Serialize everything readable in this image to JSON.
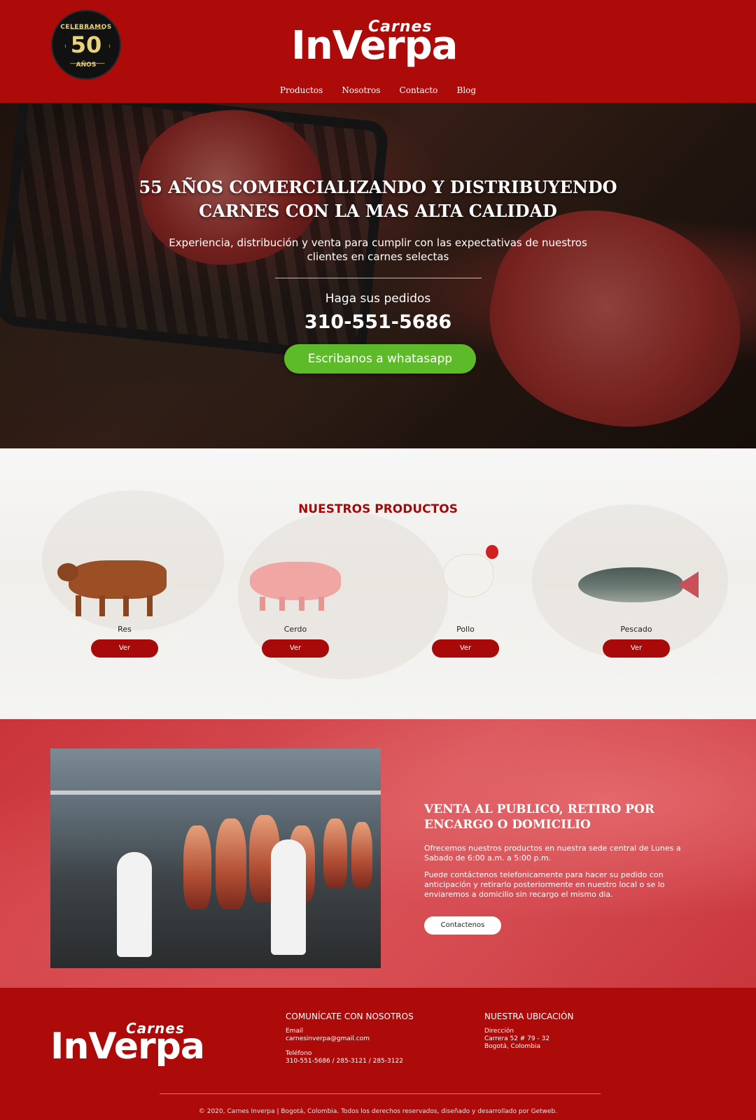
{
  "header": {
    "badge": {
      "top": "CELEBRAMOS",
      "number": "50",
      "bottom": "AÑOS"
    },
    "logo": {
      "small": "Carnes",
      "big": "InVerpa"
    },
    "nav": [
      "Productos",
      "Nosotros",
      "Contacto",
      "Blog"
    ]
  },
  "hero": {
    "title_line1": "55 AÑOS COMERCIALIZANDO Y DISTRIBUYENDO",
    "title_line2": "CARNES CON LA MAS ALTA CALIDAD",
    "subtitle": "Experiencia, distribución y venta para cumplir con las expectativas de nuestros clientes en carnes selectas",
    "order_label": "Haga sus pedidos",
    "phone": "310-551-5686",
    "whatsapp_button": "Escribanos a whatasapp"
  },
  "products": {
    "title": "NUESTROS PRODUCTOS",
    "items": [
      {
        "name": "Res",
        "button": "Ver",
        "icon": "cow-icon"
      },
      {
        "name": "Cerdo",
        "button": "Ver",
        "icon": "pig-icon"
      },
      {
        "name": "Pollo",
        "button": "Ver",
        "icon": "chicken-icon"
      },
      {
        "name": "Pescado",
        "button": "Ver",
        "icon": "fish-icon"
      }
    ]
  },
  "venta": {
    "heading_line1": "VENTA AL PUBLICO, RETIRO POR",
    "heading_line2": "ENCARGO O DOMICILIO",
    "paragraph1": "Ofrecemos nuestros productos en nuestra sede central de Lunes a Sabado de 6:00 a.m. a 5:00 p.m.",
    "paragraph2": "Puede contáctenos telefonicamente para hacer su pedido con anticipación y retirarlo posteriormente en nuestro local o  se lo enviaremos a domicilio sin recargo el mismo dia.",
    "contact_button": "Contactenos"
  },
  "footer": {
    "logo": {
      "small": "Carnes",
      "big": "InVerpa"
    },
    "contact": {
      "title": "COMUNÍCATE CON NOSOTROS",
      "email_label": "Email",
      "email": "carnesinverpa@gmail.com",
      "phone_label": "Teléfono",
      "phones": "310-551-5686 / 285-3121 / 285-3122"
    },
    "location": {
      "title": "NUESTRA UBICACIÓN",
      "address_label": "Dirección",
      "address_line1": "Carrera 52 # 79 - 32",
      "address_line2": "Bogotá, Colombia"
    },
    "copyright": "© 2020, Carnes Inverpa | Bogotá, Colombia. Todos los derechos reservados, diseñado y desarrollado por Getweb."
  },
  "colors": {
    "brand_red": "#ad0a0a",
    "whatsapp_green": "#5dbb2a",
    "button_red": "#a80a0a"
  }
}
